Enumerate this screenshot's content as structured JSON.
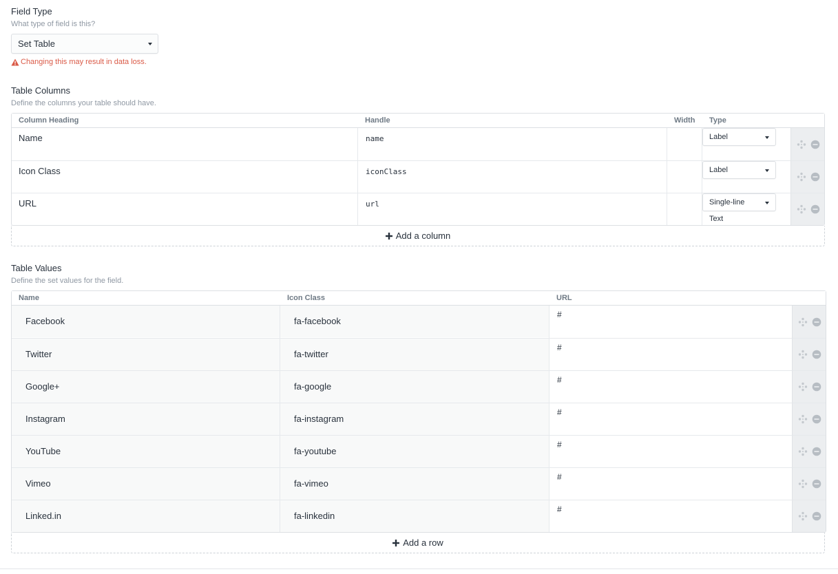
{
  "field_type": {
    "heading": "Field Type",
    "instructions": "What type of field is this?",
    "selected": "Set Table",
    "warning": "Changing this may result in data loss."
  },
  "table_columns": {
    "heading": "Table Columns",
    "instructions": "Define the columns your table should have.",
    "headers": [
      "Column Heading",
      "Handle",
      "Width",
      "Type"
    ],
    "rows": [
      {
        "heading": "Name",
        "handle": "name",
        "width": "",
        "type": "Label"
      },
      {
        "heading": "Icon Class",
        "handle": "iconClass",
        "width": "",
        "type": "Label"
      },
      {
        "heading": "URL",
        "handle": "url",
        "width": "",
        "type": "Single-line Text"
      }
    ],
    "add_label": "Add a column"
  },
  "table_values": {
    "heading": "Table Values",
    "instructions": "Define the set values for the field.",
    "headers": [
      "Name",
      "Icon Class",
      "URL"
    ],
    "rows": [
      {
        "name": "Facebook",
        "icon_class": "fa-facebook",
        "url": "#"
      },
      {
        "name": "Twitter",
        "icon_class": "fa-twitter",
        "url": "#"
      },
      {
        "name": "Google+",
        "icon_class": "fa-google",
        "url": "#"
      },
      {
        "name": "Instagram",
        "icon_class": "fa-instagram",
        "url": "#"
      },
      {
        "name": "YouTube",
        "icon_class": "fa-youtube",
        "url": "#"
      },
      {
        "name": "Vimeo",
        "icon_class": "fa-vimeo",
        "url": "#"
      },
      {
        "name": "Linked.in",
        "icon_class": "fa-linkedin",
        "url": "#"
      }
    ],
    "add_label": "Add a row"
  },
  "icons": {
    "warning": "warning-icon",
    "move": "move-icon",
    "delete": "delete-icon",
    "plus": "plus-icon",
    "caret": "caret-down-icon"
  },
  "colors": {
    "warning": "#da5a47",
    "text": "#29323d",
    "muted": "#8f98a3",
    "border": "#dcdfe3",
    "action_bg": "#eceef0"
  }
}
